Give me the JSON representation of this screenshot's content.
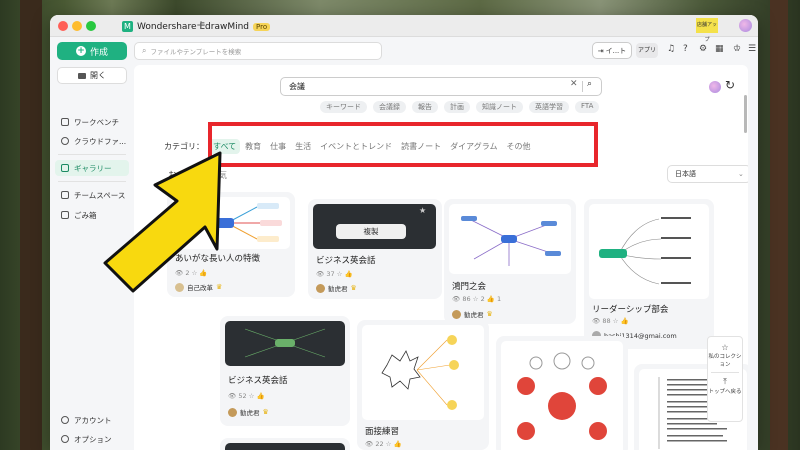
{
  "window": {
    "app_name": "Wondershare EdrawMind",
    "pro_badge": "Pro",
    "new_tab": "+",
    "upgrade_label": "店舗アップ"
  },
  "sidebar": {
    "create": "作成",
    "open": "開く",
    "items": [
      {
        "label": "ワークベンチ",
        "icon": "workbench-icon"
      },
      {
        "label": "クラウドファ...",
        "icon": "cloud-icon"
      },
      {
        "label": "ギャラリー",
        "icon": "gallery-icon",
        "active": true
      },
      {
        "label": "チームスペース",
        "icon": "team-icon"
      },
      {
        "label": "ごみ箱",
        "icon": "trash-icon"
      }
    ],
    "account": "アカウント",
    "options": "オプション"
  },
  "topbar": {
    "file_search_placeholder": "ファイルやテンプレートを検索",
    "import_label": "イ...ト",
    "app_label": "アプリ"
  },
  "gallery": {
    "search_value": "会議",
    "ghost_tags": [
      "キーワード",
      "会議録",
      "報告",
      "計画",
      "知識ノート",
      "英語学習",
      "FTA"
    ],
    "category_label": "カテゴリ：",
    "categories": [
      "すべて",
      "教育",
      "仕事",
      "生活",
      "イベントとトレンド",
      "読書ノート",
      "ダイアグラム",
      "その他"
    ],
    "active_category": "すべて",
    "sort_tabs": [
      "おすすめ",
      "人気"
    ],
    "language": "日本語"
  },
  "cards": [
    {
      "title": "あいがな長い人の特徴",
      "views": "2",
      "likes": "",
      "author": "自己改革"
    },
    {
      "title": "ビジネス英会話",
      "views": "37",
      "likes": "",
      "author": "勧虎君",
      "copy_label": "複製"
    },
    {
      "title": "鴻門之会",
      "views": "86",
      "likes": "2",
      "shares": "1",
      "author": "勧虎君"
    },
    {
      "title": "リーダーシップ部会",
      "views": "88",
      "likes": "",
      "author": "hashi1314@gmai.com"
    },
    {
      "title": "ビジネス英会話",
      "views": "52",
      "likes": "",
      "author": "勧虎君"
    },
    {
      "title": "面接練習",
      "views": "22",
      "likes": "",
      "author": ""
    }
  ],
  "float_panel": {
    "collection": "私のコレクション",
    "back_to_top": "トップへ戻る"
  },
  "colors": {
    "accent": "#1fb181",
    "highlight_box": "#e8262c",
    "arrow": "#f8d90f"
  }
}
